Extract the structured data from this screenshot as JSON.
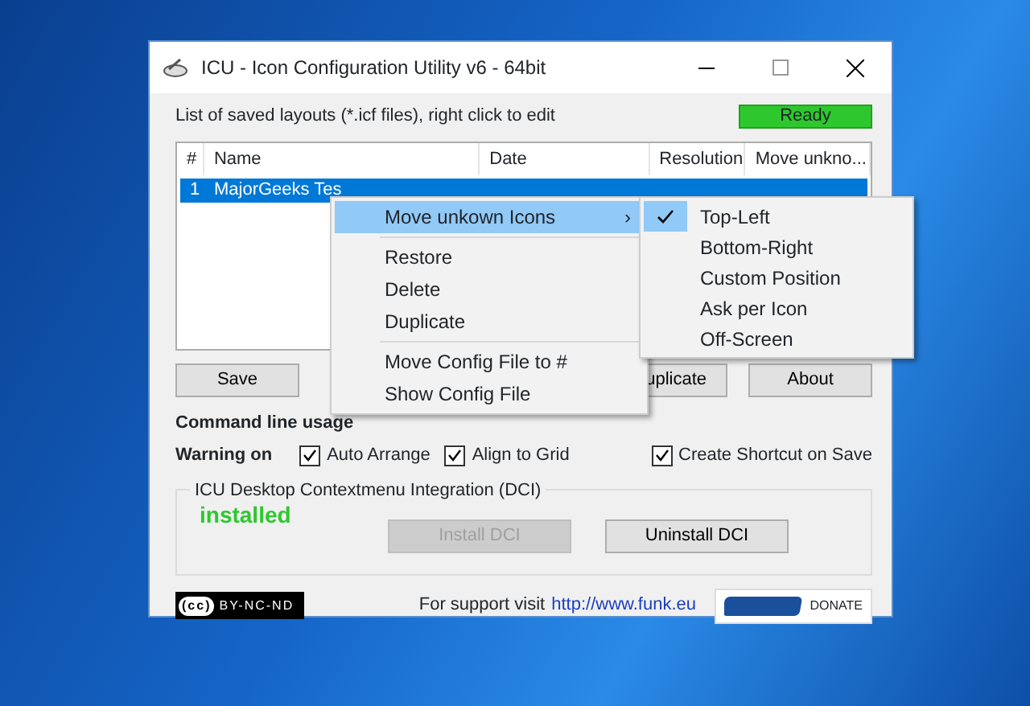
{
  "window": {
    "title": "ICU - Icon Configuration Utility v6 - 64bit"
  },
  "list_label": "List of saved layouts (*.icf files), right click to edit",
  "status": {
    "text": "Ready"
  },
  "table": {
    "columns": [
      "#",
      "Name",
      "Date",
      "Resolution",
      "Move unkno..."
    ],
    "rows": [
      {
        "cells": [
          "1",
          "MajorGeeks Tes"
        ],
        "selected": true
      }
    ]
  },
  "buttons": [
    {
      "label": "Save",
      "partly_covered": false
    },
    {
      "label": "uplicate",
      "partly_covered": true
    },
    {
      "label": "About",
      "partly_covered": false
    }
  ],
  "command_line": "Command line usage",
  "warning_label": "Warning on",
  "options": [
    {
      "label": "Auto Arrange",
      "checked": true
    },
    {
      "label": "Align to Grid",
      "checked": true
    },
    {
      "label": "Create Shortcut on Save",
      "checked": true
    }
  ],
  "dci": {
    "title": "ICU Desktop Contextmenu Integration (DCI)",
    "status": "installed",
    "buttons": [
      {
        "label": "Install DCI",
        "disabled": true
      },
      {
        "label": "Uninstall DCI",
        "disabled": false
      }
    ]
  },
  "footer": {
    "license_icon": "(cc)",
    "license": "BY-NC-ND",
    "support_text": "For support visit",
    "support_link": "http://www.funk.eu",
    "donate": "DONATE"
  },
  "context_menu": {
    "items": [
      {
        "kind": "submenu",
        "label": "Move unkown Icons",
        "arrow": "›",
        "selected": true
      },
      {
        "kind": "separator"
      },
      {
        "kind": "item",
        "label": "Restore",
        "selected": false
      },
      {
        "kind": "item",
        "label": "Delete",
        "selected": false
      },
      {
        "kind": "item",
        "label": "Duplicate",
        "selected": false
      },
      {
        "kind": "separator"
      },
      {
        "kind": "item",
        "label": "Move Config File to #",
        "selected": false
      },
      {
        "kind": "item",
        "label": "Show Config File",
        "selected": false
      }
    ]
  },
  "submenu": {
    "items": [
      {
        "label": "Top-Left",
        "checked": true
      },
      {
        "label": "Bottom-Right",
        "checked": false
      },
      {
        "label": "Custom Position",
        "checked": false
      },
      {
        "label": "Ask per Icon",
        "checked": false
      },
      {
        "label": "Off-Screen",
        "checked": false
      }
    ]
  }
}
